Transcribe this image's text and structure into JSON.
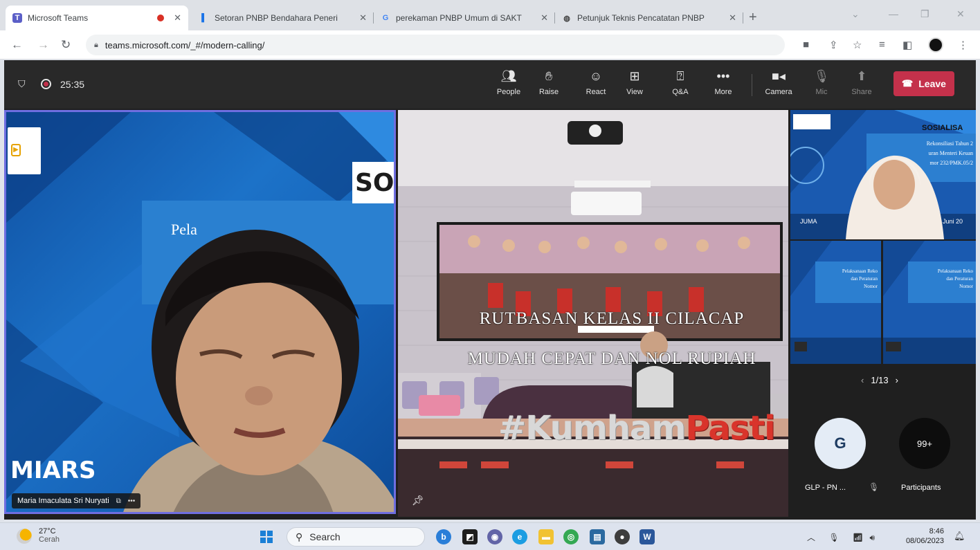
{
  "browser": {
    "tabs": [
      {
        "title": "Microsoft Teams",
        "icon": "teams-icon",
        "active": true
      },
      {
        "title": "Setoran PNBP Bendahara Peneri",
        "icon": "document-icon",
        "active": false
      },
      {
        "title": "perekaman PNBP Umum di SAKT",
        "icon": "google-icon",
        "active": false
      },
      {
        "title": "Petunjuk Teknis Pencatatan PNBP",
        "icon": "globe-icon",
        "active": false
      }
    ],
    "url": "teams.microsoft.com/_#/modern-calling/"
  },
  "meeting": {
    "timer": "25:35",
    "controls": [
      {
        "label": "People",
        "icon": "people-icon"
      },
      {
        "label": "Raise",
        "icon": "hand-icon"
      },
      {
        "label": "React",
        "icon": "smiley-icon"
      },
      {
        "label": "View",
        "icon": "grid-icon"
      },
      {
        "label": "Q&A",
        "icon": "qa-icon"
      },
      {
        "label": "More",
        "icon": "ellipsis-icon"
      },
      {
        "label": "Camera",
        "icon": "camera-icon"
      },
      {
        "label": "Mic",
        "icon": "mic-icon"
      },
      {
        "label": "Share",
        "icon": "share-icon"
      }
    ],
    "leave_label": "Leave",
    "leave_color": "#c4314b"
  },
  "main_tile": {
    "participant_name": "Maria Imaculata Sri Nuryati",
    "slide_title": "SO",
    "slide_subtitle": "Pela",
    "slide_footer": "MIARS"
  },
  "room_tile": {
    "banner_line1": "RUTBASAN KELAS II CILACAP",
    "banner_line2": "MUDAH CEPAT DAN NOL RUPIAH",
    "hashtag_main": "#Kumham",
    "hashtag_accent": "Pasti"
  },
  "side_tiles": {
    "slide_heading": "SOSIALISA",
    "slide_lines": [
      "Rekonsiliasi Tahun 2",
      "uran Menteri Keuan",
      "mor 232/PMK.05/2"
    ],
    "slide_bottom_left": "JUMA",
    "slide_bottom_right": "Juni 20",
    "small_slide_lines": [
      "Pelaksanaan Reko",
      "dan Peraturan",
      "Nomor"
    ]
  },
  "gallery": {
    "pager": "1/13",
    "participant_initial": "G",
    "participant_label": "GLP - PN ...",
    "overflow_count": "99+",
    "participants_label": "Participants"
  },
  "taskbar": {
    "temperature": "27°C",
    "weather": "Cerah",
    "search_label": "Search",
    "time": "8:46",
    "date": "08/06/2023"
  }
}
